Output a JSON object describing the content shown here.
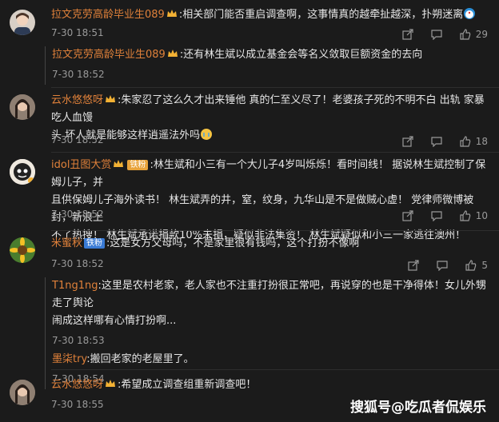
{
  "comments": [
    {
      "user": "拉文克劳高龄毕业生089",
      "text": "相关部门能否重启调查啊，这事情真的越牵扯越深，扑朔迷离",
      "time": "7-30 18:51",
      "likes": "29",
      "avatar": "cartoon-girl",
      "replies": [
        {
          "user": "拉文克劳高龄毕业生089",
          "text": "还有林生斌以成立基金会等名义敛取巨额资金的去向",
          "time": "7-30 18:52"
        }
      ]
    },
    {
      "user": "云水悠悠呀",
      "text_line1": "朱家忍了这么久才出来锤他 真的仁至义尽了！老婆孩子死的不明不白 出轨 家暴 吃人血馒",
      "text_line2": "头 坏人就是能够这样逍遥法外吗",
      "time": "7-30 18:52",
      "likes": "18",
      "avatar": "portrait"
    },
    {
      "user": "idol丑图大赏",
      "tag": "铁粉",
      "text_line1": "林生斌和小三有一个大儿子4岁叫烁烁！看时间线！ 据说林生斌控制了保姆儿子，并",
      "text_line2": "且供保姆儿子海外读书！ 林生斌弄的井，窒，纹身，九华山是不是做贼心虚！ 党律师微博被封，新浪上",
      "text_line3": "不了热搜！ 林生斌承诺捐款10%未捐，疑似非法集资！ 林生斌疑似和小三一家逃往澳州！",
      "time": "7-30 18:52",
      "likes": "10",
      "avatar": "cartoon-face"
    },
    {
      "user": "米蜜秋",
      "tag": "铁粉",
      "text": "这是女方父母吗，不是家里很有钱吗，这个打扮不像啊",
      "time": "7-30 18:52",
      "likes": "5",
      "avatar": "sunflower",
      "replies": [
        {
          "user": "T1ng1ng",
          "text_line1": "这里是农村老家，老人家也不注重打扮很正常吧，再说穿的也是干净得体！女儿外甥走了舆论",
          "text_line2": "闹成这样哪有心情打扮啊...",
          "time": "7-30 18:53"
        },
        {
          "user": "墨柒try",
          "text": "搬回老家的老屋里了。",
          "time": "7-30 18:54"
        }
      ]
    },
    {
      "user": "云水悠悠呀",
      "text": "希望成立调查组重新调查吧！",
      "time": "7-30 18:55",
      "avatar": "portrait"
    }
  ],
  "watermark": "搜狐号@吃瓜者侃娱乐"
}
